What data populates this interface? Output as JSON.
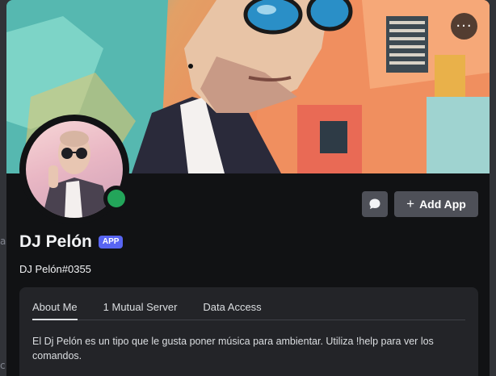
{
  "background": {
    "frag_left_1": "ac",
    "frag_left_2": "c"
  },
  "banner": {
    "more_button_label": "···"
  },
  "profile": {
    "display_name": "DJ Pelón",
    "badge": "APP",
    "username": "DJ Pelón#0355",
    "status": "online",
    "status_color": "#23a55a"
  },
  "actions": {
    "message_icon": "chat-bubble-icon",
    "add_app_label": "Add App",
    "add_app_icon": "plus-icon"
  },
  "tabs": [
    {
      "label": "About Me",
      "active": true
    },
    {
      "label": "1 Mutual Server",
      "active": false
    },
    {
      "label": "Data Access",
      "active": false
    }
  ],
  "about_me": "El Dj Pelón es un tipo que le gusta poner música para ambientar. Utiliza !help para ver los comandos.",
  "colors": {
    "accent": "#5865f2",
    "card_bg": "#111214",
    "panel_bg": "#232428",
    "button_bg": "#4e5058"
  }
}
